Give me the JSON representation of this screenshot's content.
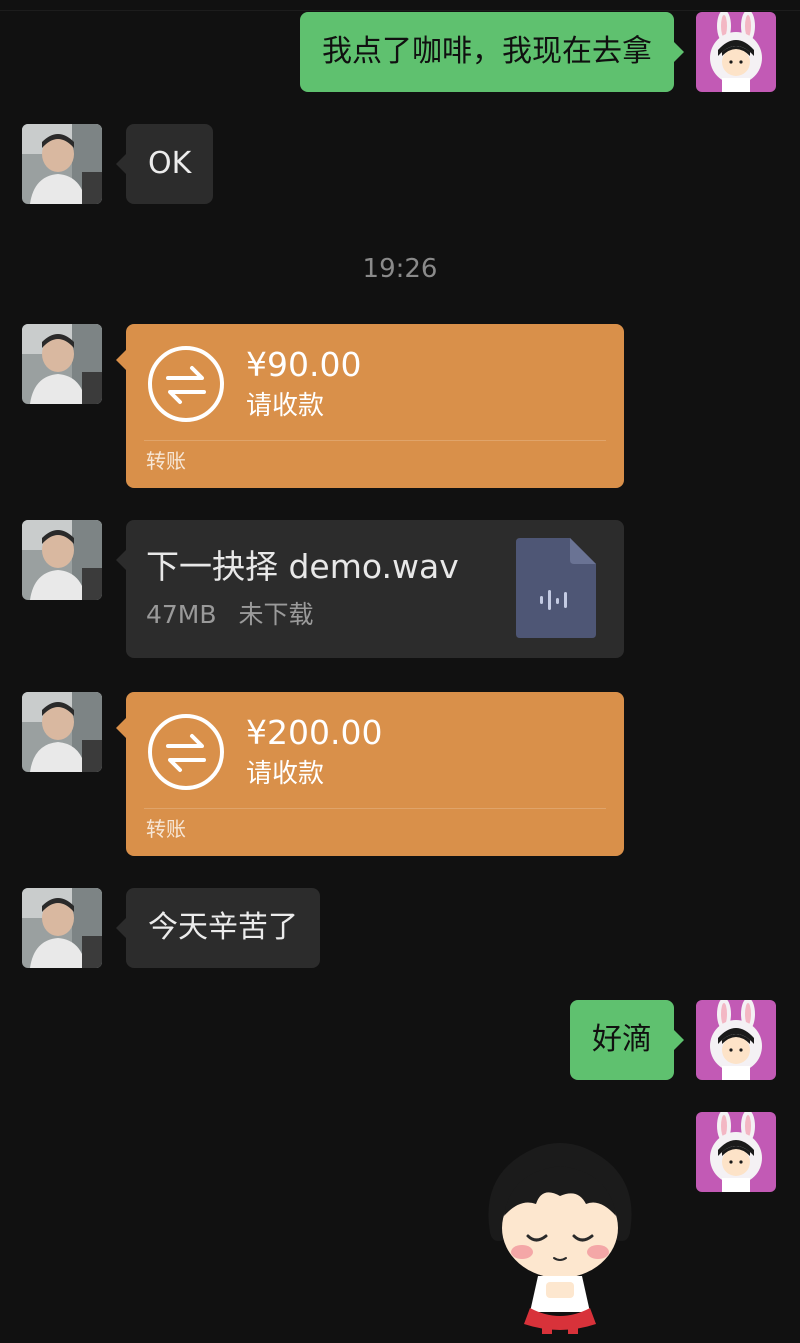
{
  "messages": [
    {
      "side": "right",
      "type": "text",
      "text": "我点了咖啡，我现在去拿"
    },
    {
      "side": "left",
      "type": "text",
      "text": "OK"
    },
    {
      "type": "time",
      "text": "19:26"
    },
    {
      "side": "left",
      "type": "transfer",
      "amount": "¥90.00",
      "status": "请收款",
      "label": "转账"
    },
    {
      "side": "left",
      "type": "file",
      "filename": "下一抉择 demo.wav",
      "size": "47MB",
      "status": "未下载"
    },
    {
      "side": "left",
      "type": "transfer",
      "amount": "¥200.00",
      "status": "请收款",
      "label": "转账"
    },
    {
      "side": "left",
      "type": "text",
      "text": "今天辛苦了"
    },
    {
      "side": "right",
      "type": "text",
      "text": "好滴"
    },
    {
      "side": "right",
      "type": "sticker",
      "sticker": "maruko-bowing-sticker"
    }
  ],
  "colors": {
    "background": "#111111",
    "outgoing_bubble": "#5fc16f",
    "incoming_bubble": "#2c2c2c",
    "transfer_bubble": "#d9904a",
    "timestamp": "#8a8a8a",
    "file_icon": "#4e5675"
  },
  "icons": {
    "transfer": "transfer-arrows-icon",
    "file": "audio-file-icon"
  }
}
